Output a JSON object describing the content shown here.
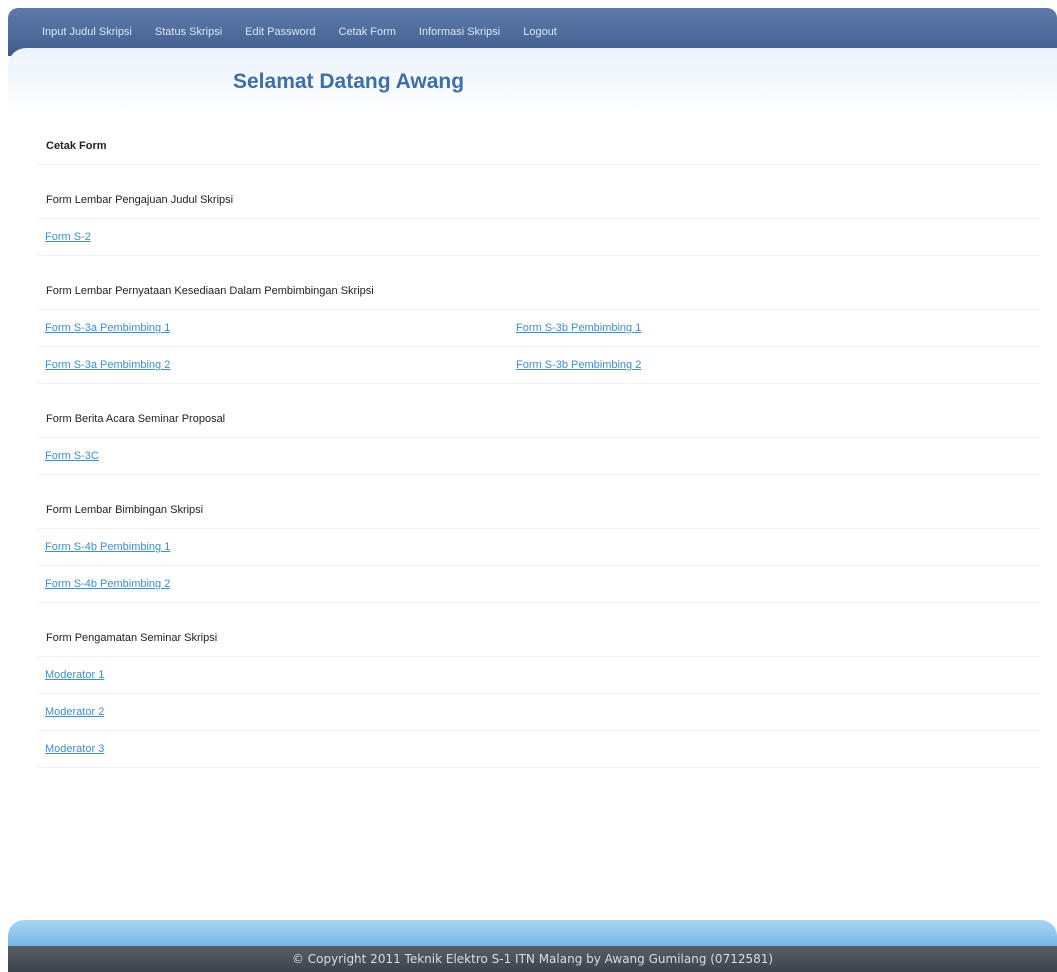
{
  "nav": {
    "items": [
      {
        "label": "Input Judul Skripsi"
      },
      {
        "label": "Status Skripsi"
      },
      {
        "label": "Edit Password"
      },
      {
        "label": "Cetak Form"
      },
      {
        "label": "Informasi Skripsi"
      },
      {
        "label": "Logout"
      }
    ]
  },
  "header": {
    "welcome": "Selamat Datang Awang"
  },
  "main": {
    "page_title": "Cetak Form",
    "sections": [
      {
        "title": "Form Lembar Pengajuan Judul Skripsi",
        "links": [
          "Form S-2"
        ]
      },
      {
        "title": "Form Lembar Pernyataan Kesediaan Dalam Pembimbingan Skripsi",
        "links_left": [
          "Form S-3a Pembimbing 1",
          "Form S-3a Pembimbing 2"
        ],
        "links_right": [
          "Form S-3b Pembimbing 1",
          "Form S-3b Pembimbing 2"
        ]
      },
      {
        "title": "Form Berita Acara Seminar Proposal",
        "links": [
          "Form S-3C"
        ]
      },
      {
        "title": "Form Lembar Bimbingan Skripsi",
        "links": [
          "Form S-4b Pembimbing 1",
          "Form S-4b Pembimbing 2"
        ]
      },
      {
        "title": "Form Pengamatan Seminar Skripsi",
        "links": [
          "Moderator 1",
          "Moderator 2",
          "Moderator 3"
        ]
      }
    ]
  },
  "footer": {
    "copyright": "© Copyright 2011 Teknik Elektro S-1 ITN Malang by Awang Gumilang (0712581)"
  },
  "colors": {
    "nav_bg": "#4e6b9c",
    "welcome_text": "#3d6fa8",
    "link": "#3b8fd4",
    "footer_bg": "#4a4f56",
    "footer_accent": "#6fb2e3"
  }
}
